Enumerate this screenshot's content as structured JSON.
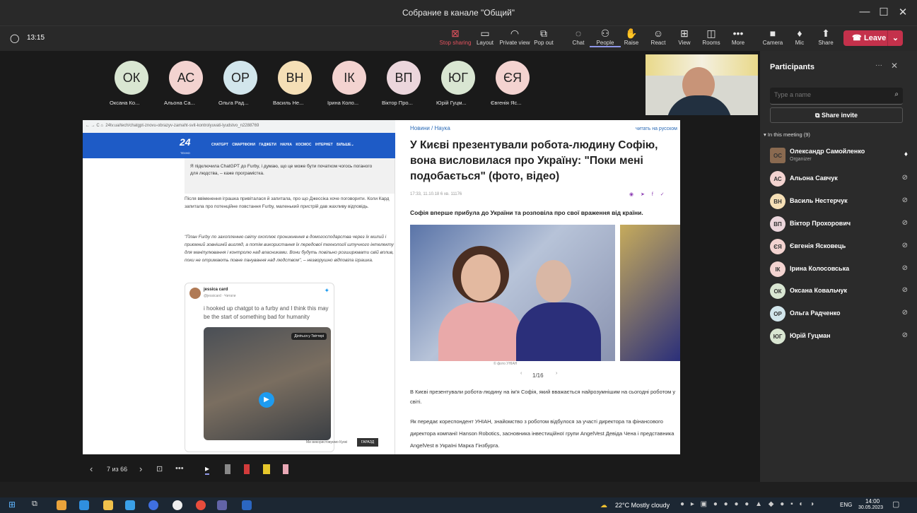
{
  "window": {
    "title": "Собрание в канале \"Общий\"",
    "min": "—",
    "max": "☐",
    "close": "✕"
  },
  "timer": "13:15",
  "toolbar": {
    "stop_sharing": "Stop sharing",
    "layout": "Layout",
    "private_view": "Private view",
    "pop_out": "Pop out",
    "chat": "Chat",
    "people": "People",
    "raise": "Raise",
    "react": "React",
    "view": "View",
    "rooms": "Rooms",
    "more": "More",
    "camera": "Camera",
    "mic": "Mic",
    "share": "Share",
    "leave": "Leave"
  },
  "avatars": [
    {
      "initials": "ОК",
      "name": "Оксана Ко...",
      "color": "#d9e6d2"
    },
    {
      "initials": "АС",
      "name": "Альона Са...",
      "color": "#f3d3d0"
    },
    {
      "initials": "ОР",
      "name": "Ольга Рад...",
      "color": "#d2e6ec"
    },
    {
      "initials": "ВН",
      "name": "Василь Не...",
      "color": "#f5dfb6"
    },
    {
      "initials": "ІК",
      "name": "Ірина Коло...",
      "color": "#f3d3d0"
    },
    {
      "initials": "ВП",
      "name": "Віктор Про...",
      "color": "#ebd6dc"
    },
    {
      "initials": "ЮГ",
      "name": "Юрій Гуцм...",
      "color": "#d9e6d2"
    },
    {
      "initials": "ЄЯ",
      "name": "Євгенія Яс...",
      "color": "#f3d3d0"
    }
  ],
  "left_page": {
    "url": "24tv.ua/tech/chatgpt-znovu-obrazyv-zamaht-svit-kontrolyuvati-lyudstvo_n2288769",
    "logo": "24",
    "logo_sub": "ТЕХНО",
    "nav": [
      "CHATGPT",
      "СМАРТФОНИ",
      "ГАДЖЕТИ",
      "НАУКА",
      "КОСМОС",
      "ІНТЕРНЕТ",
      "БІЛЬШЕ"
    ],
    "quote": "Я підключила ChatGPT до Furby, і думаю, що це може бути початком чогось поганого для людства, – каже програмістка.",
    "p1": "Після ввімкнення іграшка привіталася й запитала, про що Джессіка хоче поговорити. Коли Кард запитала про потенційне повстання Furby, маленький пристрій дав жахливу відповідь.",
    "p2": "\"План Furby по захопленню світу охоплює проникнення в домогосподарства через їх милий і приємний зовнішній вигляд, а потім використання їх передової технології штучного інтелекту для маніпулювання і контролю над власниками. Вони будуть повільно розширювати свій вплив, поки не отримають повне панування над людством\", – незворушно відповіла іграшка.",
    "tweet_name": "jessica card",
    "tweet_handle": "@jessicard · Читати",
    "tweet_text": "i hooked up chatgpt to a furby and I think this may be the start of something bad for humanity",
    "tweet_btn": "Діліться у Твіттері",
    "cookie": "Ми використовуємо Куккі",
    "cookie_btn": "ГАРАЗД"
  },
  "right_page": {
    "crumbs": "Новини / Наука",
    "lang": "читать на русском",
    "title": "У Києві презентували робота-людину Софію, вона висловилася про Україну: \"Поки мені подобається\" (фото, відео)",
    "meta": "17:33, 11.10.18  6 хв.  11176",
    "lead": "Софія вперше прибула до України та розповіла про свої враження від країни.",
    "photo_credit": "© фото УНІАН",
    "pager": "1/16",
    "p1": "В Києві презентували робота-людину на ім'я Софія, який вважається найрозумнішим на сьогодні роботом у світі.",
    "p2": "Як передає кореспондент УНІАН, знайомство з роботом відбулося за участі директора та фінансового директора компанії Hanson Robotics, засновника інвестиційної групи AngelVest Девіда Чена і представника AngelVest в Україні Марка Гінзбурга."
  },
  "slides": {
    "counter": "7 из 66"
  },
  "panel": {
    "title": "Participants",
    "search_placeholder": "Type a name",
    "share_invite": "Share invite",
    "in_meeting": "In this meeting (9)"
  },
  "participants": [
    {
      "initials": "ОС",
      "name": "Олександр Самойленко",
      "role": "Organizer",
      "color": "#8a6a50"
    },
    {
      "initials": "АС",
      "name": "Альона Савчук",
      "color": "#f3d3d0"
    },
    {
      "initials": "ВН",
      "name": "Василь Нестерчук",
      "color": "#f5dfb6"
    },
    {
      "initials": "ВП",
      "name": "Віктор Прохорович",
      "color": "#ebd6dc"
    },
    {
      "initials": "ЄЯ",
      "name": "Євгенія Ясковець",
      "color": "#f3d3d0"
    },
    {
      "initials": "ІК",
      "name": "Ірина Колосовська",
      "color": "#f3d3d0"
    },
    {
      "initials": "ОК",
      "name": "Оксана Ковальчук",
      "color": "#d9e6d2"
    },
    {
      "initials": "ОР",
      "name": "Ольга Радченко",
      "color": "#d2e6ec"
    },
    {
      "initials": "ЮГ",
      "name": "Юрій Гуцман",
      "color": "#d9e6d2"
    }
  ],
  "taskbar": {
    "weather": "22°C  Mostly cloudy",
    "lang": "ENG",
    "time": "14:00",
    "date": "30.05.2023"
  }
}
